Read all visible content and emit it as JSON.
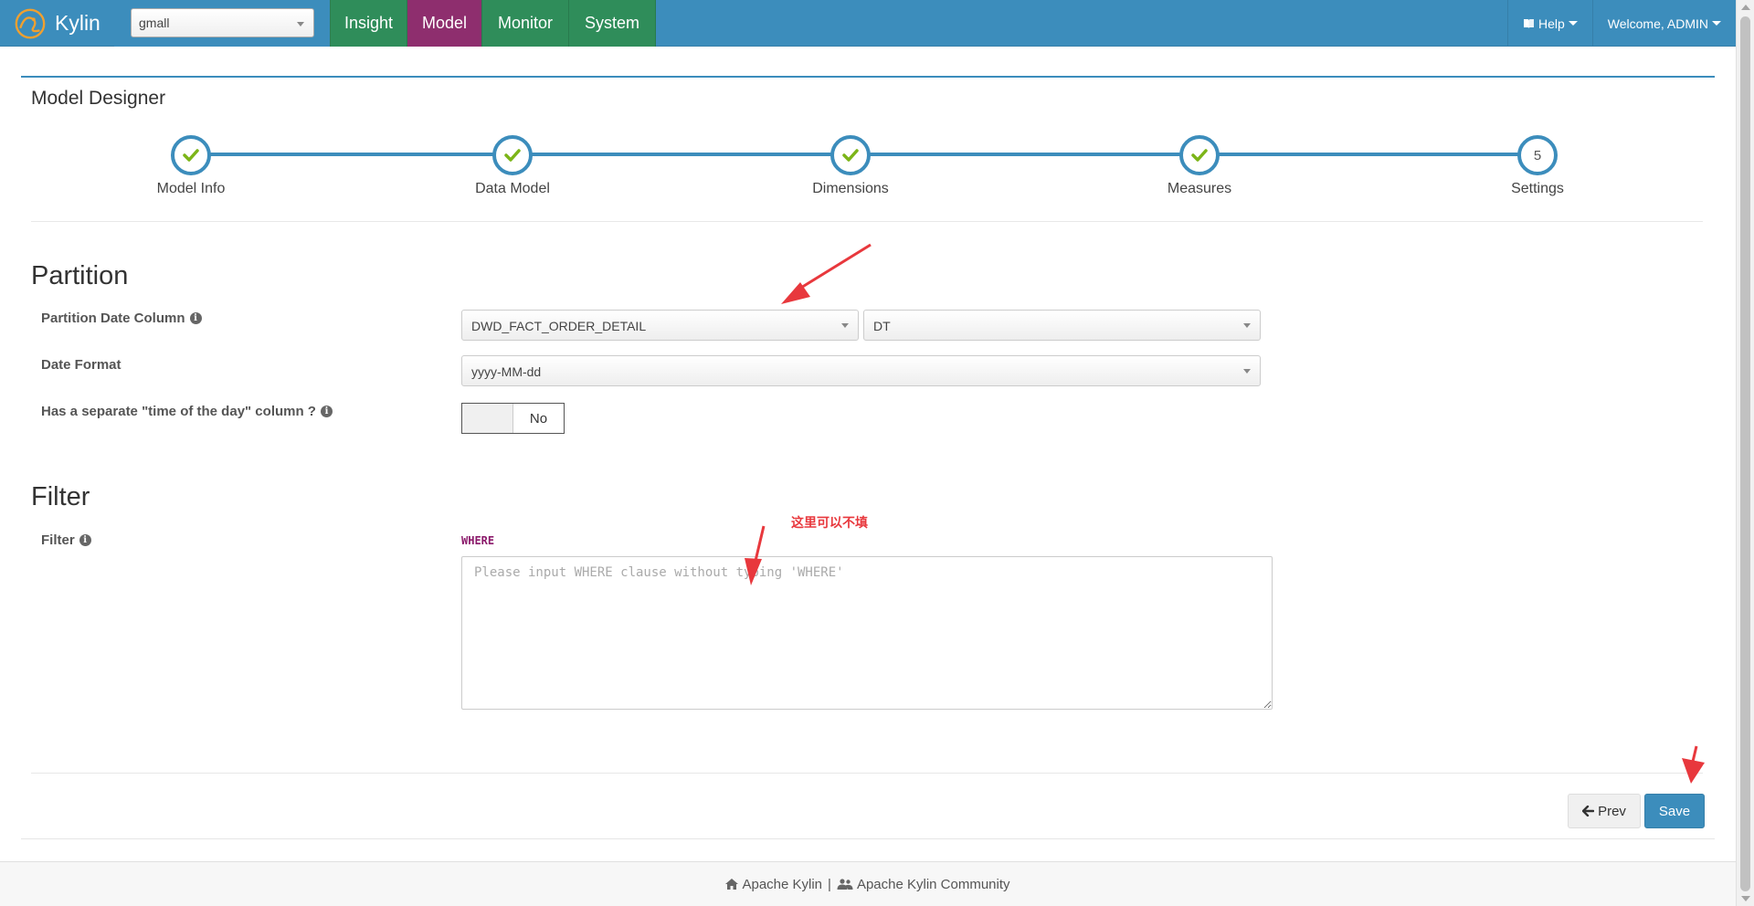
{
  "header": {
    "brand": "Kylin",
    "project": "gmall",
    "tabs": [
      {
        "label": "Insight",
        "active": false
      },
      {
        "label": "Model",
        "active": true
      },
      {
        "label": "Monitor",
        "active": false
      },
      {
        "label": "System",
        "active": false
      }
    ],
    "help": "Help",
    "welcome": "Welcome, ADMIN"
  },
  "page": {
    "title": "Model Designer"
  },
  "wizard": {
    "steps": [
      {
        "label": "Model Info",
        "state": "done"
      },
      {
        "label": "Data Model",
        "state": "done"
      },
      {
        "label": "Dimensions",
        "state": "done"
      },
      {
        "label": "Measures",
        "state": "done"
      },
      {
        "label": "Settings",
        "state": "current",
        "number": "5"
      }
    ]
  },
  "partition": {
    "title": "Partition",
    "date_column_label": "Partition Date Column",
    "table_value": "DWD_FACT_ORDER_DETAIL",
    "column_value": "DT",
    "date_format_label": "Date Format",
    "date_format_value": "yyyy-MM-dd",
    "time_of_day_label": "Has a separate \"time of the day\" column ?",
    "time_of_day_value": "No"
  },
  "filter": {
    "title": "Filter",
    "label": "Filter",
    "keyword": "WHERE",
    "placeholder": "Please input WHERE clause without typing 'WHERE'",
    "value": ""
  },
  "annotation": {
    "note": "这里可以不填",
    "color": "#e8383d"
  },
  "buttons": {
    "prev": "Prev",
    "save": "Save"
  },
  "footer": {
    "link1": "Apache Kylin",
    "separator": "|",
    "link2": "Apache Kylin Community"
  },
  "colors": {
    "navbar": "#3c8dbc",
    "tab": "#2f8d5a",
    "active_tab": "#8e2e6e",
    "check": "#7cb518"
  }
}
